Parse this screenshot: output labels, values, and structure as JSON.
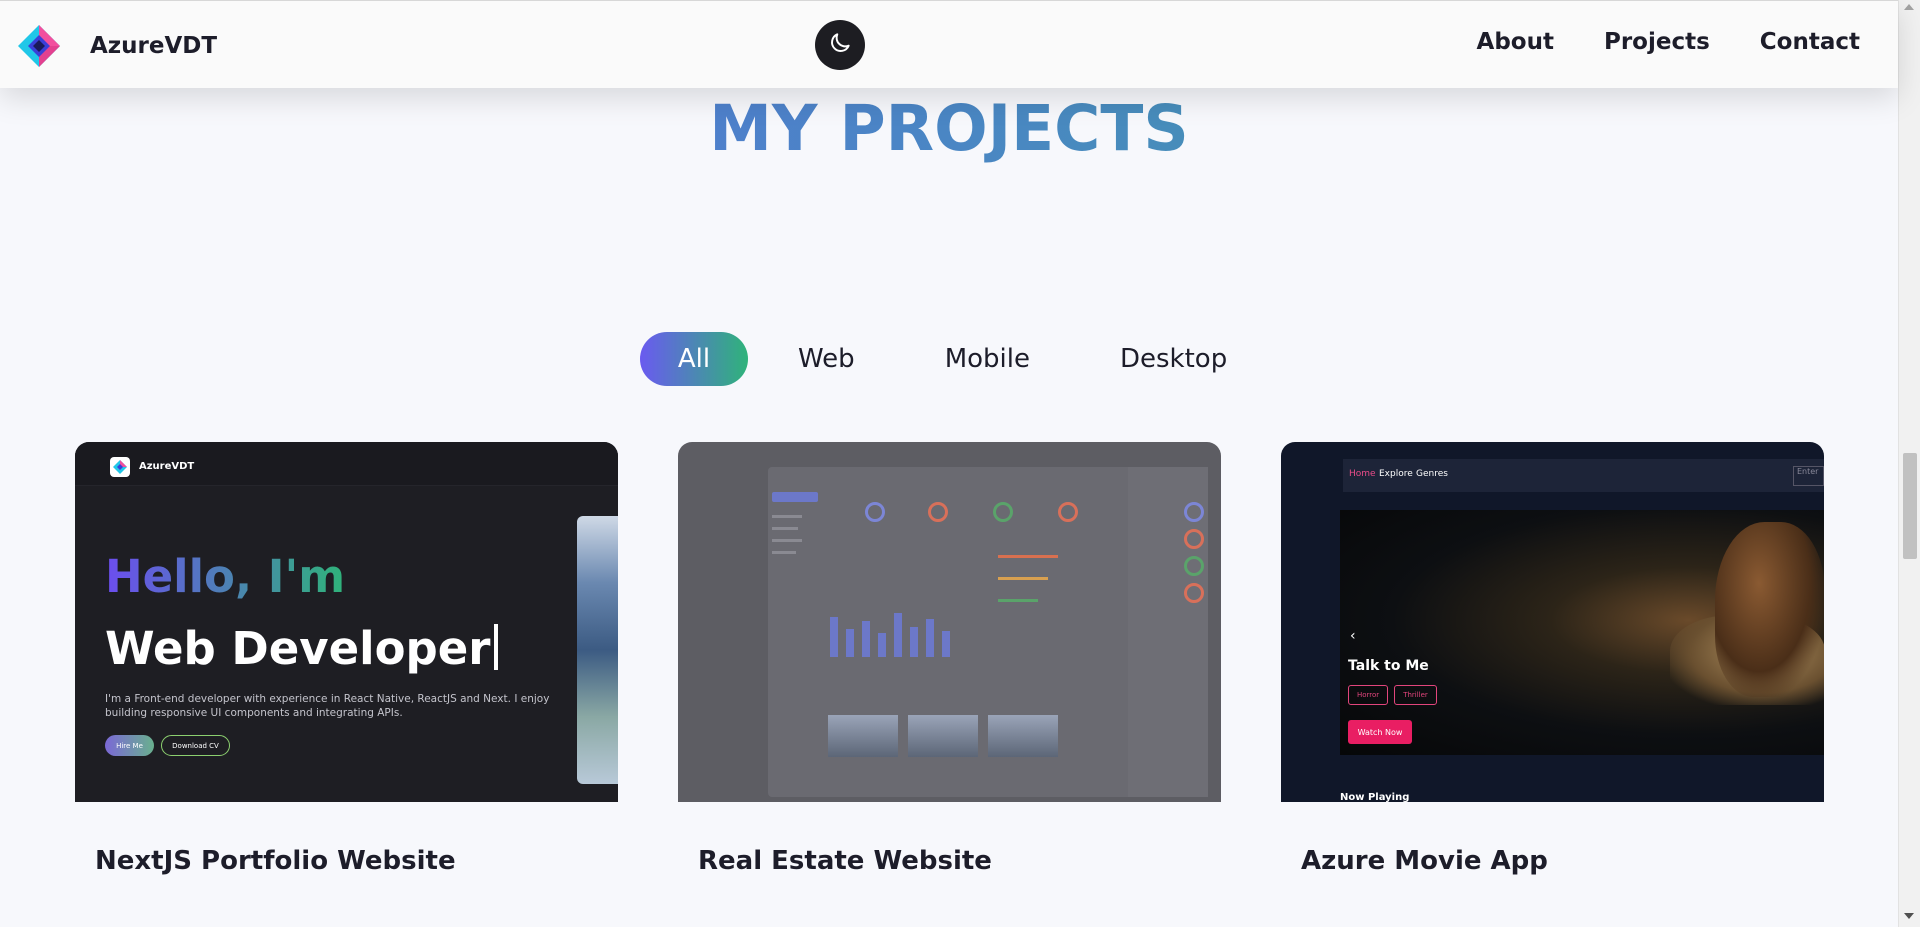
{
  "header": {
    "brand": "AzureVDT",
    "theme_toggle_icon": "moon-icon",
    "nav": [
      "About",
      "Projects",
      "Contact"
    ]
  },
  "section": {
    "title": "MY PROJECTS"
  },
  "filters": [
    "All",
    "Web",
    "Mobile",
    "Desktop"
  ],
  "active_filter": "All",
  "colors": {
    "title_gradient_start": "#5a6fe0",
    "title_gradient_end": "#3ea19d",
    "active_tab_start": "#6a5af0",
    "active_tab_end": "#2fb37a",
    "movie_accent": "#e91e63"
  },
  "projects": [
    {
      "title": "NextJS Portfolio Website",
      "preview": {
        "brand": "AzureVDT",
        "greeting": "Hello, I'm",
        "role": "Web Developer",
        "description": "I'm a Front-end developer with experience in React Native, ReactJS and Next. I enjoy building responsive UI components and integrating APIs.",
        "primary_button": "Hire Me",
        "secondary_button": "Download CV"
      }
    },
    {
      "title": "Real Estate Website",
      "preview": {}
    },
    {
      "title": "Azure Movie App",
      "preview": {
        "nav": [
          "Home",
          "Explore",
          "Genres"
        ],
        "search_placeholder": "Enter",
        "featured_title": "Talk to Me",
        "genres": [
          "Horror",
          "Thriller"
        ],
        "cta": "Watch Now",
        "section_label": "Now Playing"
      }
    }
  ]
}
